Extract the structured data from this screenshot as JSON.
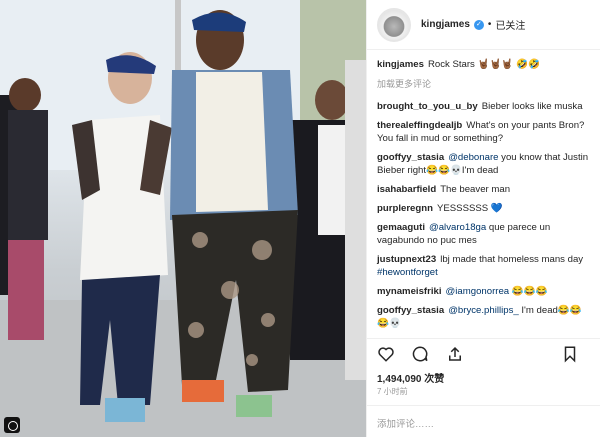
{
  "post": {
    "username": "kingjames",
    "follow_label": "已关注",
    "separator": "•",
    "caption": {
      "user": "kingjames",
      "text": "Rock Stars 🤘🏾🤘🏾🤘🏾 🤣🤣"
    },
    "load_more": "加载更多评论",
    "comments": [
      {
        "user": "brought_to_you_u_by",
        "parts": [
          {
            "t": "Bieber looks like muska"
          }
        ]
      },
      {
        "user": "therealeffingdealjb",
        "parts": [
          {
            "t": "What's on your pants Bron? You fall in mud or something?"
          }
        ]
      },
      {
        "user": "gooffyy_stasia",
        "parts": [
          {
            "m": "@debonare"
          },
          {
            "t": " you know that Justin Bieber right😂😂💀I'm dead"
          }
        ]
      },
      {
        "user": "isahabarfield",
        "parts": [
          {
            "t": "The beaver man"
          }
        ]
      },
      {
        "user": "purpleregnn",
        "parts": [
          {
            "t": "YESSSSSS 💙"
          }
        ]
      },
      {
        "user": "gemaaguti",
        "parts": [
          {
            "m": "@alvaro18ga"
          },
          {
            "t": " que parece un vagabundo no puc mes"
          }
        ]
      },
      {
        "user": "justupnext23",
        "parts": [
          {
            "t": "lbj made that homeless mans day "
          },
          {
            "m": "#hewontforget"
          }
        ]
      },
      {
        "user": "mynameisfriki",
        "parts": [
          {
            "m": "@iamgonorrea"
          },
          {
            "t": " 😂😂😂"
          }
        ]
      },
      {
        "user": "gooffyy_stasia",
        "parts": [
          {
            "m": "@bryce.phillips_"
          },
          {
            "t": " I'm dead😂😂😂💀"
          }
        ]
      }
    ],
    "likes": "1,494,090 次赞",
    "time": "7 小时前",
    "add_comment_placeholder": "添加评论……"
  },
  "icons": {
    "like": "heart-icon",
    "comment": "comment-icon",
    "share": "share-icon",
    "save": "bookmark-icon"
  }
}
